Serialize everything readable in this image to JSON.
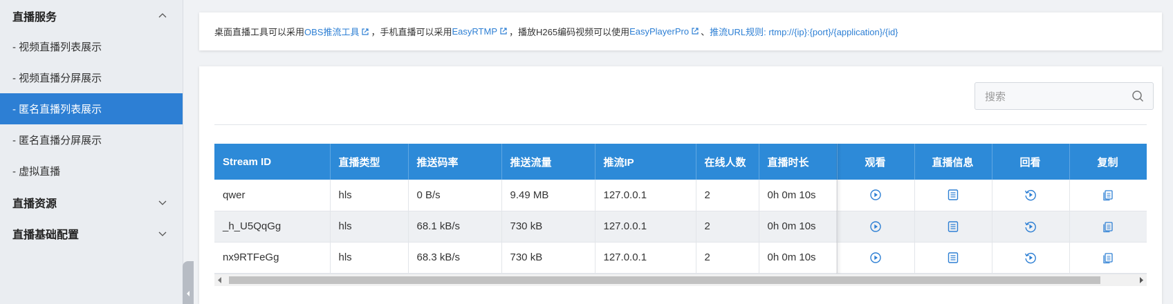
{
  "sidebar": {
    "groups": [
      {
        "label": "直播服务",
        "expanded": true
      },
      {
        "label": "直播资源",
        "expanded": false
      },
      {
        "label": "直播基础配置",
        "expanded": false
      }
    ],
    "items": [
      {
        "label": "- 视频直播列表展示",
        "active": false
      },
      {
        "label": "- 视频直播分屏展示",
        "active": false
      },
      {
        "label": "- 匿名直播列表展示",
        "active": true
      },
      {
        "label": "- 匿名直播分屏展示",
        "active": false
      },
      {
        "label": "- 虚拟直播",
        "active": false
      }
    ]
  },
  "notice": {
    "t1": "桌面直播工具可以采用 ",
    "link_obs": "OBS推流工具",
    "t2": "，手机直播可以采用 ",
    "link_easyrtmp": "EasyRTMP",
    "t3": "，播放H265编码视频可以使用 ",
    "link_easyplayer": "EasyPlayerPro",
    "t4": "、",
    "link_rule": "推流URL规则: rtmp://{ip}:{port}/{application}/{id}"
  },
  "search": {
    "placeholder": "搜索"
  },
  "table": {
    "headers": [
      "Stream ID",
      "直播类型",
      "推送码率",
      "推送流量",
      "推流IP",
      "在线人数",
      "直播时长",
      "观看",
      "直播信息",
      "回看",
      "复制"
    ],
    "rows": [
      [
        "qwer",
        "hls",
        "0 B/s",
        "9.49 MB",
        "127.0.0.1",
        "2",
        "0h 0m 10s"
      ],
      [
        "_h_U5QqGg",
        "hls",
        "68.1 kB/s",
        "730 kB",
        "127.0.0.1",
        "2",
        "0h 0m 10s"
      ],
      [
        "nx9RTFeGg",
        "hls",
        "68.3 kB/s",
        "730 kB",
        "127.0.0.1",
        "2",
        "0h 0m 10s"
      ]
    ],
    "action_icons": [
      "play-icon",
      "info-list-icon",
      "replay-icon",
      "copy-icon"
    ]
  },
  "colors": {
    "accent": "#2d7fd4",
    "header": "#2d8ad8",
    "sidebar_bg": "#eaedf1"
  }
}
